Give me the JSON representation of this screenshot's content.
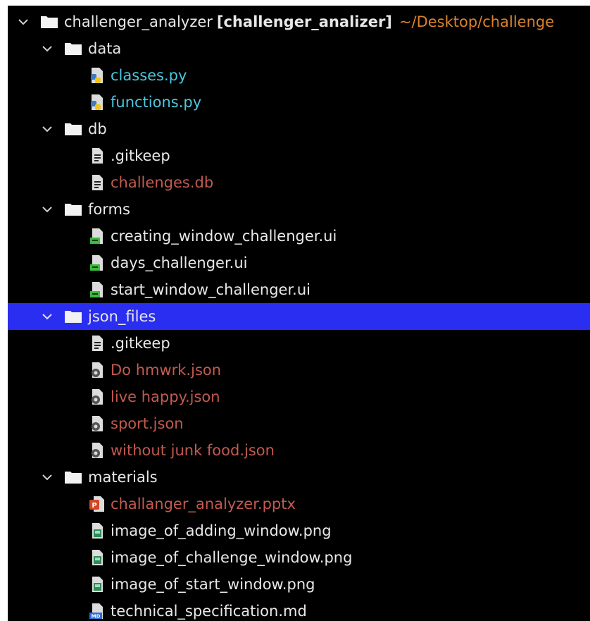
{
  "colors": {
    "background": "#000000",
    "selection": "#2a2ef0",
    "python_file": "#4cc7df",
    "ignored_file": "#c25a4f",
    "path_text": "#d9822b",
    "default_text": "#e8e8e8"
  },
  "project": {
    "name": "challenger_analyzer",
    "module": "[challenger_analizer]",
    "path": "~/Desktop/challenge"
  },
  "tree": [
    {
      "label": "data",
      "icon": "folder-icon"
    },
    {
      "label": "classes.py",
      "icon": "python-file-icon"
    },
    {
      "label": "functions.py",
      "icon": "python-file-icon"
    },
    {
      "label": "db",
      "icon": "folder-icon"
    },
    {
      "label": ".gitkeep",
      "icon": "text-file-icon"
    },
    {
      "label": "challenges.db",
      "icon": "text-file-icon"
    },
    {
      "label": "forms",
      "icon": "folder-icon"
    },
    {
      "label": "creating_window_challenger.ui",
      "icon": "qt-ui-file-icon"
    },
    {
      "label": "days_challenger.ui",
      "icon": "qt-ui-file-icon"
    },
    {
      "label": "start_window_challenger.ui",
      "icon": "qt-ui-file-icon"
    },
    {
      "label": "json_files",
      "icon": "folder-icon",
      "selected": true
    },
    {
      "label": ".gitkeep",
      "icon": "text-file-icon"
    },
    {
      "label": "Do hmwrk.json",
      "icon": "json-file-icon"
    },
    {
      "label": "live happy.json",
      "icon": "json-file-icon"
    },
    {
      "label": "sport.json",
      "icon": "json-file-icon"
    },
    {
      "label": "without junk food.json",
      "icon": "json-file-icon"
    },
    {
      "label": "materials",
      "icon": "folder-icon"
    },
    {
      "label": "challanger_analyzer.pptx",
      "icon": "powerpoint-file-icon"
    },
    {
      "label": "image_of_adding_window.png",
      "icon": "image-file-icon"
    },
    {
      "label": "image_of_challenge_window.png",
      "icon": "image-file-icon"
    },
    {
      "label": "image_of_start_window.png",
      "icon": "image-file-icon"
    },
    {
      "label": "technical_specification.md",
      "icon": "markdown-file-icon"
    }
  ]
}
